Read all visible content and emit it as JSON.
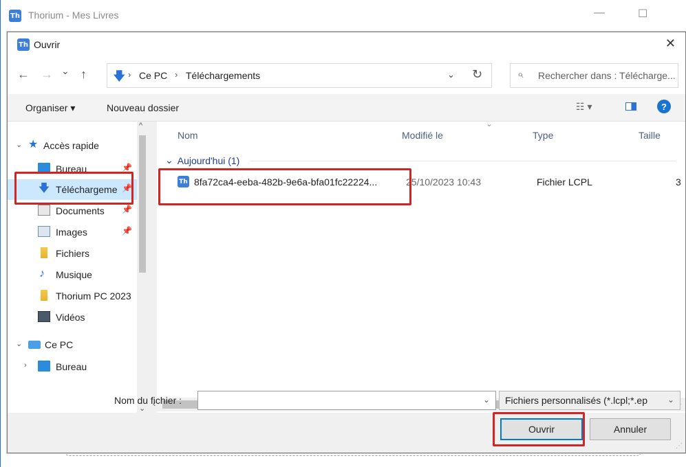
{
  "background_window": {
    "title": "Thorium - Mes Livres",
    "minimize": "—",
    "maximize": "☐"
  },
  "dialog": {
    "title": "Ouvrir",
    "app_icon_text": "Th",
    "close": "✕"
  },
  "address": {
    "back": "←",
    "forward": "→",
    "recent": "⌄",
    "up": "↑",
    "crumbs": [
      "Ce PC",
      "Téléchargements"
    ],
    "separator": "›",
    "refresh": "↻",
    "search_placeholder": "Rechercher dans : Télécharge..."
  },
  "toolbar": {
    "organize": "Organiser ▾",
    "new_folder": "Nouveau dossier",
    "view_icon": "☷ ▾",
    "help": "?"
  },
  "nav": {
    "items": [
      {
        "label": "Accès rapide",
        "icon": "star-icon",
        "expander": "⌄"
      },
      {
        "label": "Bureau",
        "icon": "desktop-icon",
        "pin": "✎"
      },
      {
        "label": "Téléchargeme",
        "icon": "download-icon",
        "pin": "✎"
      },
      {
        "label": "Documents",
        "icon": "documents-icon",
        "pin": "✎"
      },
      {
        "label": "Images",
        "icon": "images-icon",
        "pin": "✎"
      },
      {
        "label": "Fichiers",
        "icon": "folder-icon"
      },
      {
        "label": "Musique",
        "icon": "music-icon"
      },
      {
        "label": "Thorium PC 2023",
        "icon": "folder-icon"
      },
      {
        "label": "Vidéos",
        "icon": "videos-icon"
      },
      {
        "label": "Ce PC",
        "icon": "pc-icon",
        "expander": "⌄"
      },
      {
        "label": "Bureau",
        "icon": "desktop-icon",
        "expander": "›"
      }
    ]
  },
  "files": {
    "columns": [
      "Nom",
      "Modifié le",
      "Type",
      "Taille"
    ],
    "group": "Aujourd'hui (1)",
    "group_caret": "⌄",
    "rows": [
      {
        "name": "8fa72ca4-eeba-482b-9e6a-bfa01fc22224...",
        "modified": "25/10/2023 10:43",
        "type": "Fichier LCPL",
        "size": "3"
      }
    ]
  },
  "bottom": {
    "filename_label": "Nom du fichier :",
    "filename_value": "",
    "filetype": "Fichiers personnalisés (*.lcpl;*.ep",
    "open": "Ouvrir",
    "cancel": "Annuler"
  },
  "colors": {
    "accent": "#0078d7",
    "highlight": "#d32424",
    "selected_bg": "#cce8ff"
  }
}
